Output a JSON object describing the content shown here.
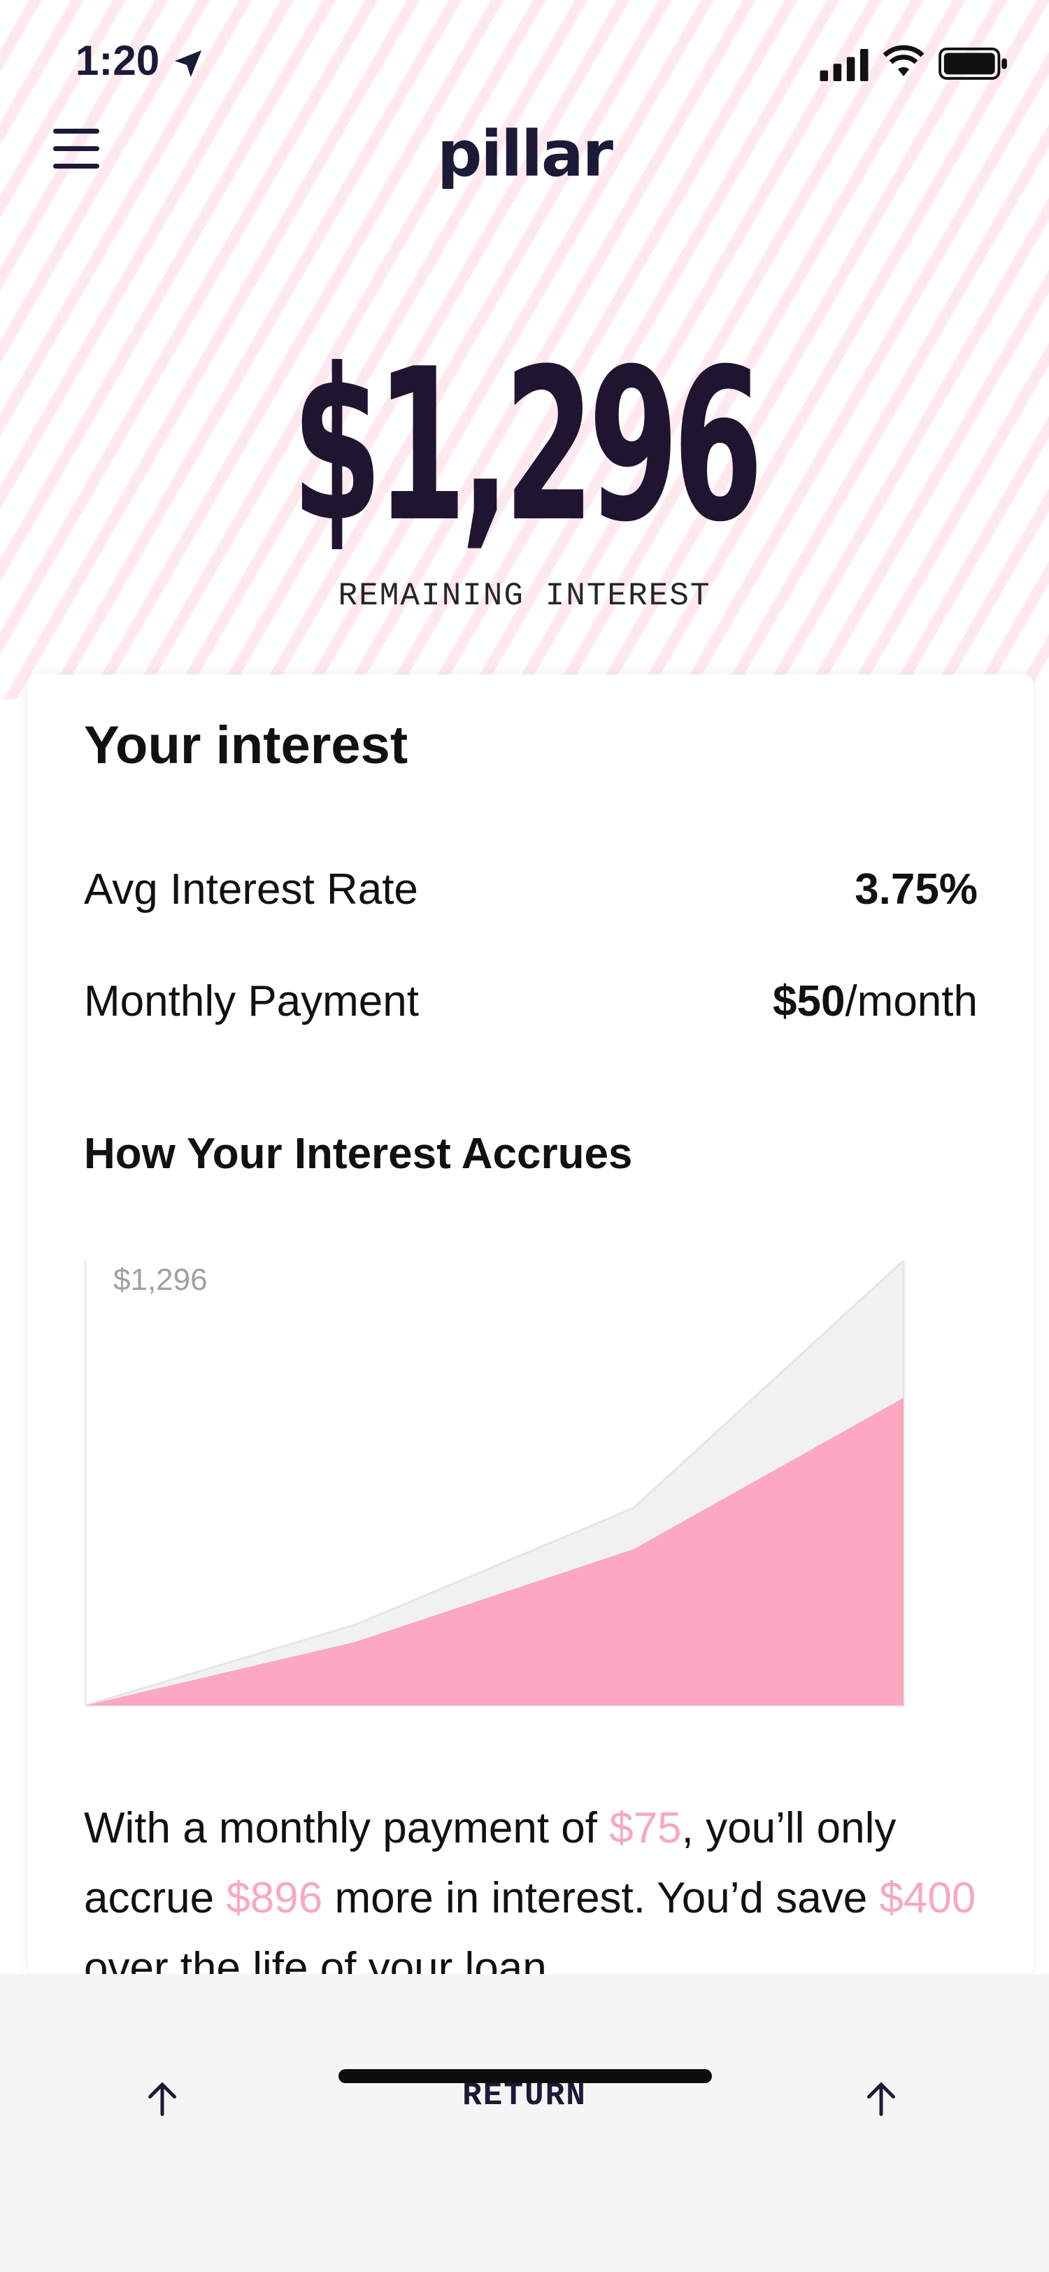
{
  "status_bar": {
    "time": "1:20"
  },
  "header": {
    "logo": "pillar"
  },
  "hero": {
    "amount": "$1,296",
    "caption": "REMAINING INTEREST"
  },
  "card": {
    "title": "Your interest",
    "rows": [
      {
        "label": "Avg Interest Rate",
        "value": "3.75%",
        "suffix": ""
      },
      {
        "label": "Monthly Payment",
        "value": "$50",
        "suffix": "/month"
      }
    ],
    "chart_title": "How Your Interest Accrues",
    "blurb": {
      "p1": "With a monthly payment of ",
      "amount1": "$75",
      "p2": ", you’ll only accrue ",
      "amount2": "$896",
      "p3": " more in interest. You’d save ",
      "amount3": "$400",
      "p4": " over the life of your loan."
    }
  },
  "chart_data": {
    "type": "area",
    "ylim": [
      0,
      1296
    ],
    "top_label": "$1,296",
    "grid": false,
    "legend": "none",
    "series": [
      {
        "values": [
          0,
          235,
          575,
          1296
        ],
        "color": "#f1f1f1"
      },
      {
        "values": [
          0,
          185,
          455,
          896
        ],
        "color": "#fba8c0"
      }
    ]
  },
  "footer": {
    "return_label": "RETURN"
  },
  "colors": {
    "accent_pink": "#f7a8c2",
    "navy": "#1b1a37"
  }
}
